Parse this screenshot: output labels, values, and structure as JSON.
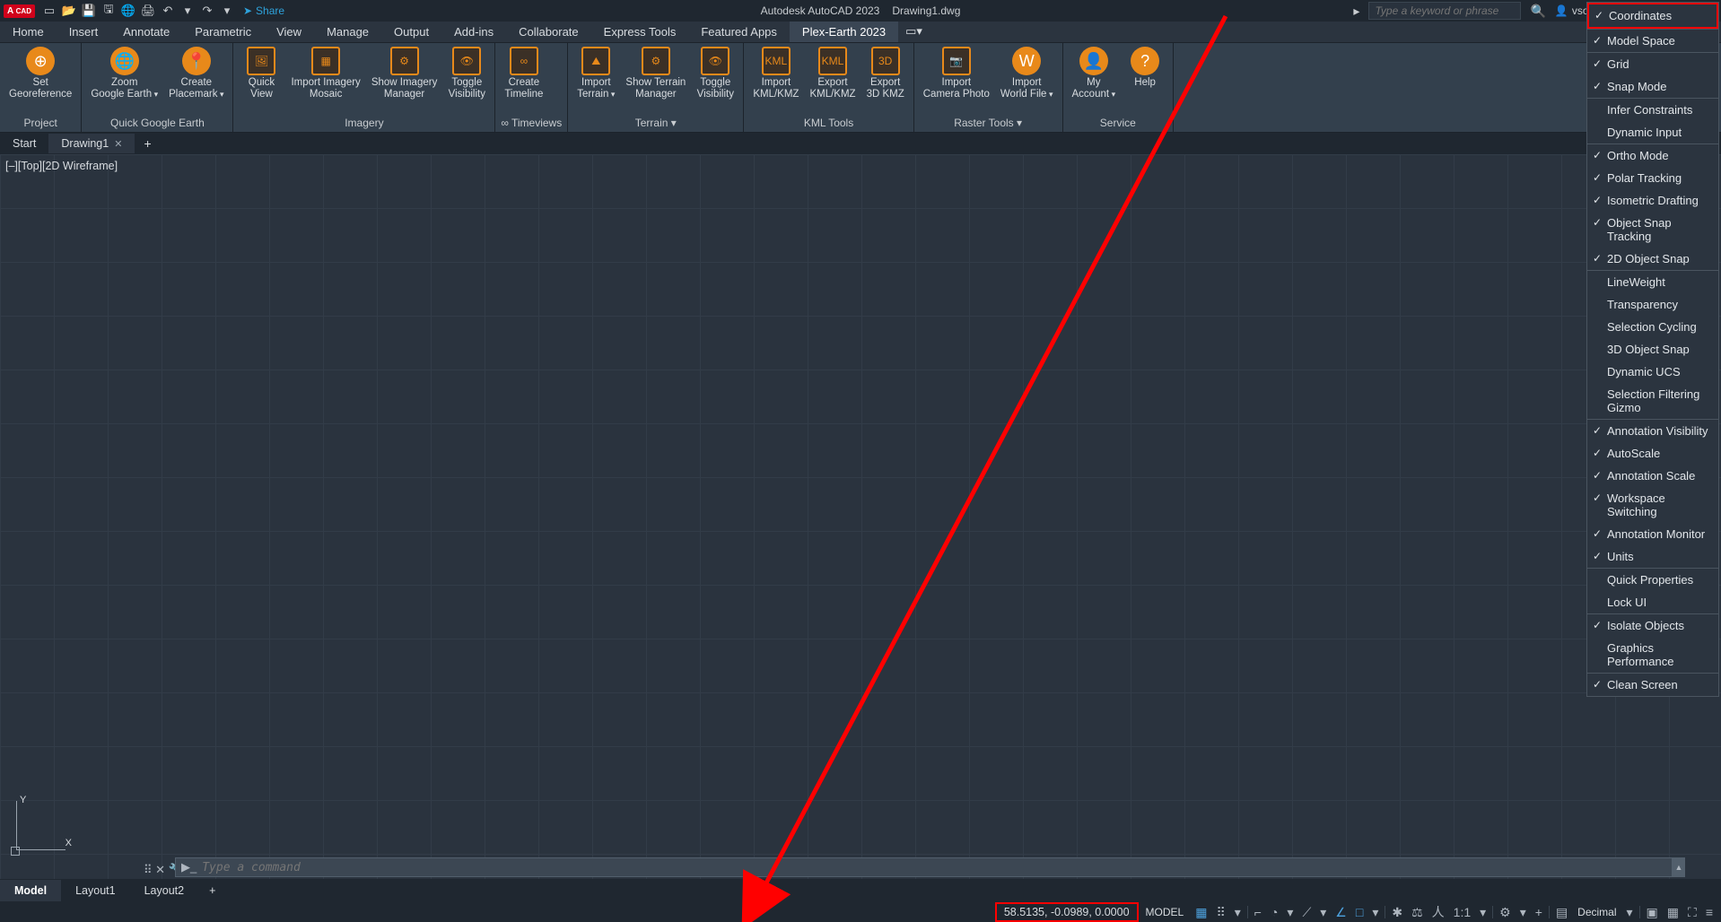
{
  "title": {
    "app": "Autodesk AutoCAD 2023",
    "file": "Drawing1.dwg"
  },
  "share_label": "Share",
  "search_placeholder": "Type a keyword or phrase",
  "username": "vsoulioti",
  "menus": [
    "Home",
    "Insert",
    "Annotate",
    "Parametric",
    "View",
    "Manage",
    "Output",
    "Add-ins",
    "Collaborate",
    "Express Tools",
    "Featured Apps",
    "Plex-Earth 2023"
  ],
  "menu_active": "Plex-Earth 2023",
  "ribbon": {
    "project": {
      "label": "Project",
      "btns": [
        {
          "l": "Set\nGeoreference"
        }
      ]
    },
    "qge": {
      "label": "Quick Google Earth",
      "btns": [
        {
          "l": "Zoom\nGoogle Earth",
          "d": true
        },
        {
          "l": "Create\nPlacemark",
          "d": true
        }
      ]
    },
    "imagery": {
      "label": "Imagery",
      "btns": [
        {
          "l": "Quick\nView"
        },
        {
          "l": "Import Imagery\nMosaic"
        },
        {
          "l": "Show Imagery\nManager"
        },
        {
          "l": "Toggle\nVisibility"
        }
      ]
    },
    "timeviews": {
      "label": "∞ Timeviews",
      "btns": [
        {
          "l": "Create\nTimeline"
        }
      ]
    },
    "terrain": {
      "label": "Terrain ▾",
      "btns": [
        {
          "l": "Import\nTerrain",
          "d": true
        },
        {
          "l": "Show Terrain\nManager"
        },
        {
          "l": "Toggle\nVisibility"
        }
      ]
    },
    "kml": {
      "label": "KML Tools",
      "btns": [
        {
          "l": "Import\nKML/KMZ"
        },
        {
          "l": "Export\nKML/KMZ"
        },
        {
          "l": "Export\n3D KMZ"
        }
      ]
    },
    "raster": {
      "label": "Raster Tools ▾",
      "btns": [
        {
          "l": "Import\nCamera Photo"
        },
        {
          "l": "Import\nWorld File",
          "d": true
        }
      ]
    },
    "service": {
      "label": "Service",
      "btns": [
        {
          "l": "My\nAccount",
          "d": true
        },
        {
          "l": "Help"
        }
      ]
    }
  },
  "filetabs": {
    "start": "Start",
    "drawing": "Drawing1"
  },
  "viewlabel": "[–][Top][2D Wireframe]",
  "ucs": {
    "y": "Y",
    "x": "X"
  },
  "cmd_placeholder": "Type a command",
  "layout_tabs": {
    "model": "Model",
    "l1": "Layout1",
    "l2": "Layout2"
  },
  "status": {
    "coords": "58.5135, -0.0989, 0.0000",
    "model": "MODEL",
    "scale": "1:1",
    "dim": "Decimal"
  },
  "ctx": [
    {
      "l": "Coordinates",
      "c": true,
      "hl": true
    },
    {
      "l": "Model Space",
      "c": true
    },
    {
      "l": "Grid",
      "c": true
    },
    {
      "l": "Snap Mode",
      "c": true
    },
    {
      "l": "Infer Constraints",
      "c": false
    },
    {
      "l": "Dynamic Input",
      "c": false
    },
    {
      "l": "Ortho Mode",
      "c": true
    },
    {
      "l": "Polar Tracking",
      "c": true
    },
    {
      "l": "Isometric Drafting",
      "c": true
    },
    {
      "l": "Object Snap Tracking",
      "c": true
    },
    {
      "l": "2D Object Snap",
      "c": true
    },
    {
      "l": "LineWeight",
      "c": false
    },
    {
      "l": "Transparency",
      "c": false
    },
    {
      "l": "Selection Cycling",
      "c": false
    },
    {
      "l": "3D Object Snap",
      "c": false
    },
    {
      "l": "Dynamic UCS",
      "c": false
    },
    {
      "l": "Selection Filtering Gizmo",
      "c": false
    },
    {
      "l": "Annotation Visibility",
      "c": true
    },
    {
      "l": "AutoScale",
      "c": true
    },
    {
      "l": "Annotation Scale",
      "c": true
    },
    {
      "l": "Workspace Switching",
      "c": true
    },
    {
      "l": "Annotation Monitor",
      "c": true
    },
    {
      "l": "Units",
      "c": true
    },
    {
      "l": "Quick Properties",
      "c": false
    },
    {
      "l": "Lock UI",
      "c": false
    },
    {
      "l": "Isolate Objects",
      "c": true
    },
    {
      "l": "Graphics Performance",
      "c": false
    },
    {
      "l": "Clean Screen",
      "c": true
    }
  ]
}
